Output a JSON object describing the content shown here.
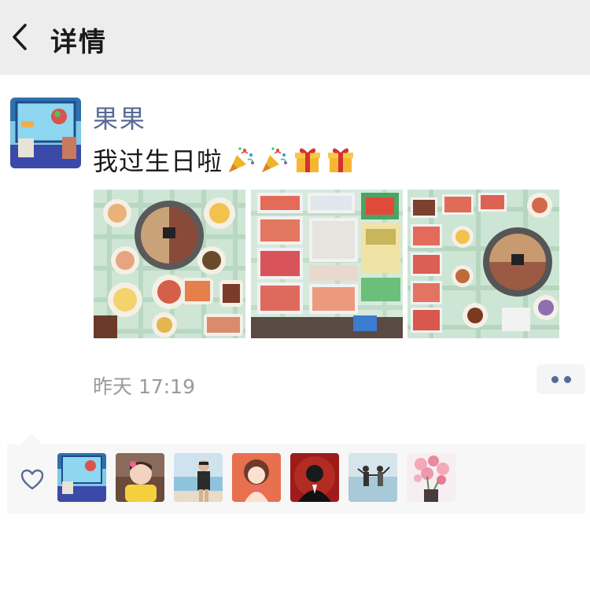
{
  "nav": {
    "title": "详情"
  },
  "post": {
    "username": "果果",
    "text": "我过生日啦",
    "emojis": [
      "party-popper",
      "party-popper",
      "gift",
      "gift"
    ],
    "time": "昨天 17:19",
    "photos": [
      "hotpot-spread",
      "meat-and-seafood-trays",
      "hotpot-table"
    ]
  },
  "likes": {
    "users": [
      "guoguo",
      "child-in-yellow",
      "man-at-beach",
      "cartoon-woman",
      "man-in-suit",
      "couple-on-beach",
      "pink-flowers"
    ]
  },
  "colors": {
    "name": "#576b95",
    "nav_bg": "#ededed",
    "likes_bg": "#f7f7f7",
    "time": "#9a9a9a"
  }
}
